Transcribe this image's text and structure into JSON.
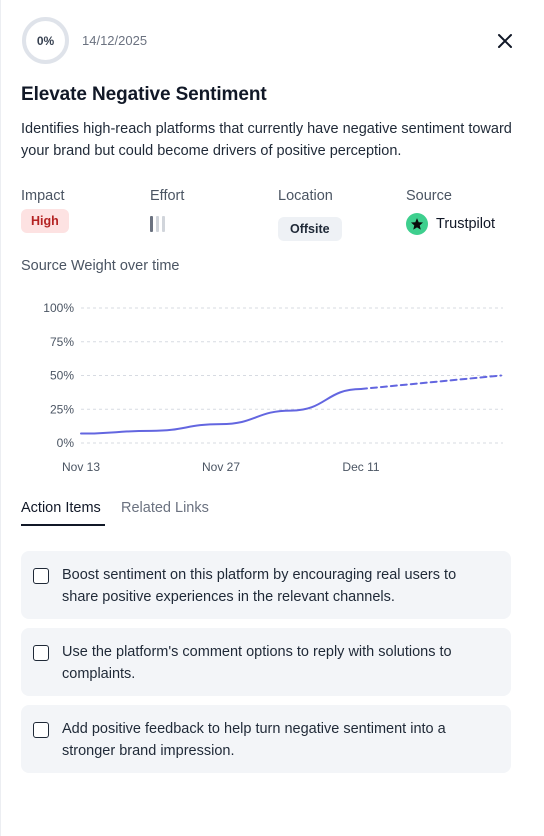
{
  "header": {
    "progress": "0%",
    "date": "14/12/2025"
  },
  "title": "Elevate Negative Sentiment",
  "description": "Identifies high-reach platforms that currently have negative sentiment toward your brand but could become drivers of positive perception.",
  "meta": {
    "impact": {
      "label": "Impact",
      "value": "High"
    },
    "effort": {
      "label": "Effort",
      "level": 1,
      "max": 3
    },
    "location": {
      "label": "Location",
      "value": "Offsite"
    },
    "source": {
      "label": "Source",
      "value": "Trustpilot",
      "icon": "trustpilot-star-icon"
    }
  },
  "chart_title": "Source Weight over time",
  "chart_data": {
    "type": "line",
    "yticks": [
      "100%",
      "75%",
      "50%",
      "25%",
      "0%"
    ],
    "xticks": [
      "Nov 13",
      "Nov 27",
      "Dec 11"
    ],
    "ylim": [
      0,
      100
    ],
    "grid": true,
    "series": [
      {
        "style": "solid",
        "x": [
          "Nov 13",
          "Nov 20",
          "Nov 27",
          "Dec 4",
          "Dec 11"
        ],
        "y": [
          7,
          9,
          14,
          24,
          40
        ]
      },
      {
        "style": "dashed",
        "x": [
          "Dec 11",
          "Dec 25"
        ],
        "y": [
          40,
          50
        ]
      }
    ]
  },
  "tabs": [
    {
      "label": "Action Items",
      "active": true
    },
    {
      "label": "Related Links",
      "active": false
    }
  ],
  "actions": [
    {
      "text": "Boost sentiment on this platform by encouraging real users to share positive experiences in the relevant channels.",
      "checked": false
    },
    {
      "text": "Use the platform's comment options to reply with solutions to complaints.",
      "checked": false
    },
    {
      "text": "Add positive feedback to help turn negative sentiment into a stronger brand impression.",
      "checked": false
    }
  ],
  "colors": {
    "line": "#6366e0",
    "high_badge_bg": "#fde2e2",
    "high_badge_text": "#b42323",
    "trustpilot": "#3ecf8e"
  }
}
